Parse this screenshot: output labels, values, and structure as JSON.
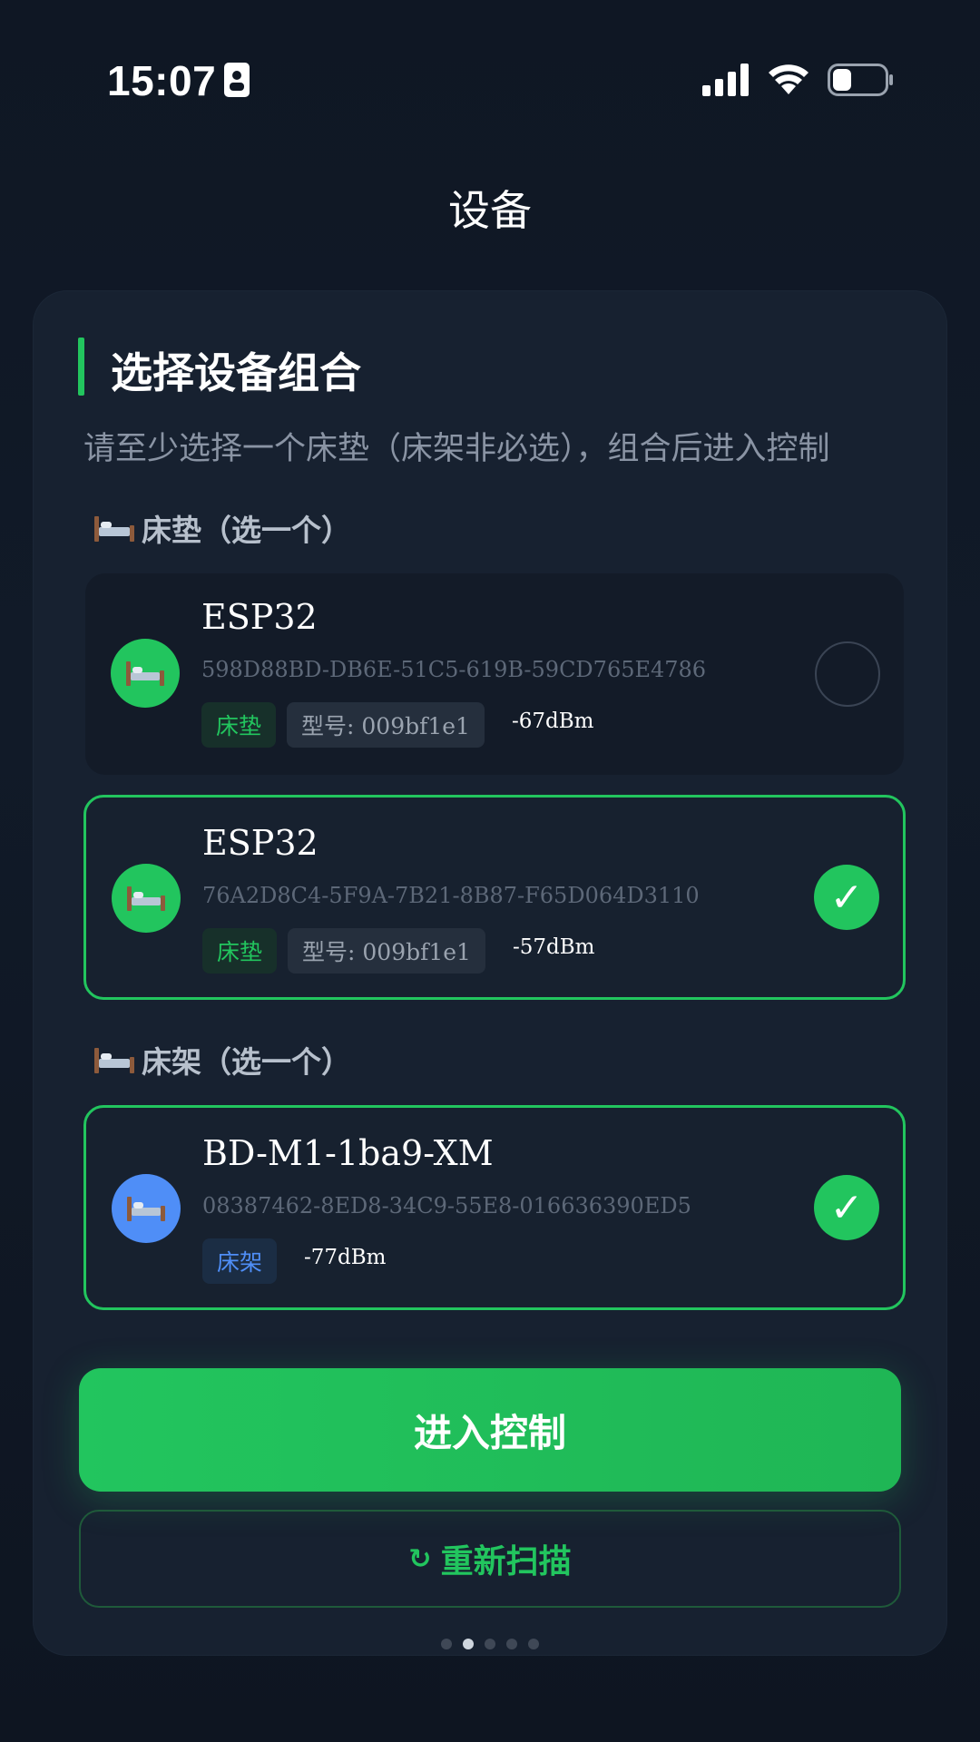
{
  "status_bar": {
    "time": "15:07",
    "icons": [
      "contact-card-icon",
      "cellular-signal-icon",
      "wifi-icon",
      "battery-icon"
    ]
  },
  "page_title": "设备",
  "card": {
    "title": "选择设备组合",
    "subtitle": "请至少选择一个床垫（床架非必选），组合后进入控制"
  },
  "groups": {
    "mattress_label": "床垫（选一个）",
    "frame_label": "床架（选一个）"
  },
  "devices": [
    {
      "name": "ESP32",
      "uuid": "598D88BD-DB6E-51C5-619B-59CD765E4786",
      "type_tag": "床垫",
      "model": "型号: 009bf1e1",
      "rssi": "-67dBm",
      "selected": false
    },
    {
      "name": "ESP32",
      "uuid": "76A2D8C4-5F9A-7B21-8B87-F65D064D3110",
      "type_tag": "床垫",
      "model": "型号: 009bf1e1",
      "rssi": "-57dBm",
      "selected": true
    },
    {
      "name": "BD-M1-1ba9-XM",
      "uuid": "08387462-8ED8-34C9-55E8-016636390ED5",
      "type_tag": "床架",
      "rssi": "-77dBm",
      "selected": true
    }
  ],
  "check_glyph": "✓",
  "buttons": {
    "enter_control": "进入控制",
    "rescan": "重新扫描",
    "rescan_icon": "↻"
  },
  "colors": {
    "accent": "#22c55e",
    "frame_blue": "#4f8ef7",
    "background": "#0f1622",
    "card": "#172130"
  },
  "pager": {
    "total": 5,
    "active_index": 1
  }
}
